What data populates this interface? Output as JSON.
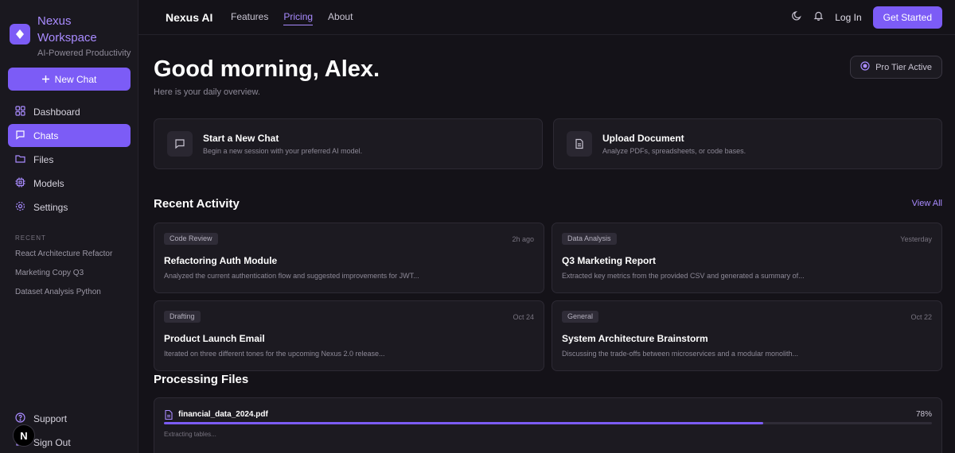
{
  "sidebar": {
    "brand_name": "Nexus Workspace",
    "brand_tag": "AI-Powered Productivity",
    "new_chat": "New Chat",
    "items": [
      {
        "label": "Dashboard",
        "icon": "grid-icon"
      },
      {
        "label": "Chats",
        "icon": "chat-icon",
        "active": true
      },
      {
        "label": "Files",
        "icon": "folder-icon"
      },
      {
        "label": "Models",
        "icon": "cpu-icon"
      },
      {
        "label": "Settings",
        "icon": "gear-icon"
      }
    ],
    "recent_heading": "RECENT",
    "recent": [
      "React Architecture Refactor",
      "Marketing Copy Q3",
      "Dataset Analysis Python"
    ],
    "support": "Support",
    "sign_out": "Sign Out",
    "n_badge": "N"
  },
  "topbar": {
    "brand": "Nexus AI",
    "links": [
      "Features",
      "Pricing",
      "About"
    ],
    "active_link": "Pricing",
    "login": "Log In",
    "cta": "Get Started"
  },
  "main": {
    "greeting": "Good morning, Alex.",
    "subtitle": "Here is your daily overview.",
    "pro_badge": "Pro Tier Active",
    "actions": [
      {
        "title": "Start a New Chat",
        "desc": "Begin a new session with your preferred AI model.",
        "icon": "message-icon"
      },
      {
        "title": "Upload Document",
        "desc": "Analyze PDFs, spreadsheets, or code bases.",
        "icon": "document-icon"
      }
    ],
    "recent_title": "Recent Activity",
    "view_all": "View All",
    "activity": [
      {
        "tag": "Code Review",
        "time": "2h ago",
        "title": "Refactoring Auth Module",
        "desc": "Analyzed the current authentication flow and suggested improvements for JWT..."
      },
      {
        "tag": "Data Analysis",
        "time": "Yesterday",
        "title": "Q3 Marketing Report",
        "desc": "Extracted key metrics from the provided CSV and generated a summary of..."
      },
      {
        "tag": "Drafting",
        "time": "Oct 24",
        "title": "Product Launch Email",
        "desc": "Iterated on three different tones for the upcoming Nexus 2.0 release..."
      },
      {
        "tag": "General",
        "time": "Oct 22",
        "title": "System Architecture Brainstorm",
        "desc": "Discussing the trade-offs between microservices and a modular monolith..."
      }
    ],
    "processing_title": "Processing Files",
    "file": {
      "name": "financial_data_2024.pdf",
      "percent_label": "78%",
      "progress": 0.78,
      "status": "Extracting tables..."
    }
  },
  "colors": {
    "accent": "#7c5cf6",
    "accent_text": "#a98bff",
    "background": "#141218"
  }
}
